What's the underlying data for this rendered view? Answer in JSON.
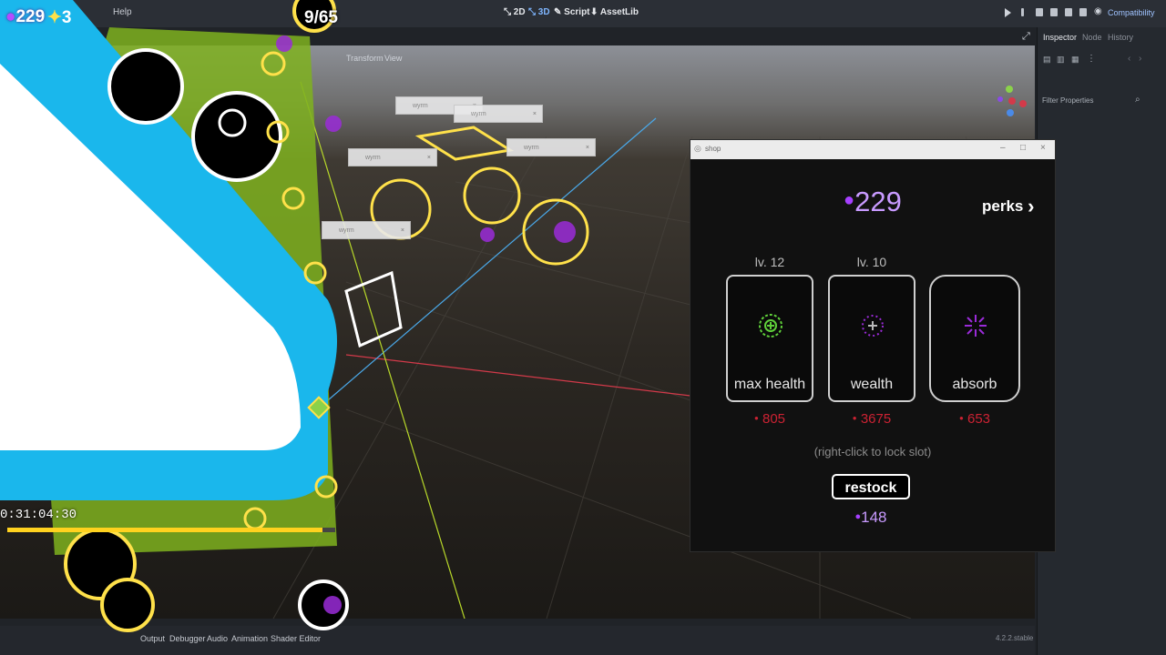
{
  "editor": {
    "menu": [
      "Help"
    ],
    "workspaces": [
      {
        "label": "2D",
        "icon": "2d-icon"
      },
      {
        "label": "3D",
        "icon": "3d-icon",
        "active": true
      },
      {
        "label": "Script",
        "icon": "script-icon"
      },
      {
        "label": "AssetLib",
        "icon": "assetlib-icon"
      }
    ],
    "renderer": "Compatibility",
    "viewport_menu": [
      "Transform",
      "View"
    ],
    "dock_tabs": [
      "Inspector",
      "Node",
      "History"
    ],
    "filter_placeholder": "Filter Properties",
    "bottom_tabs": [
      "Output",
      "Debugger",
      "Audio",
      "Animation",
      "Shader Editor"
    ],
    "version": "4.2.2.stable"
  },
  "hud": {
    "score": "229",
    "stars": "3",
    "enemy_count": "9/65",
    "timer": "0:31:04:30",
    "progress": 0.96
  },
  "mini_windows": [
    "wyrm",
    "wyrm",
    "wyrm",
    "wyrm",
    "wyrm"
  ],
  "shop": {
    "window_title": "shop",
    "coins": "229",
    "perks_label": "perks",
    "slots": [
      {
        "level": "lv. 12",
        "name": "max health",
        "price": "805",
        "icon": "max-health-icon"
      },
      {
        "level": "lv. 10",
        "name": "wealth",
        "price": "3675",
        "icon": "wealth-icon"
      },
      {
        "level": "",
        "name": "absorb",
        "price": "653",
        "icon": "absorb-icon"
      }
    ],
    "hint": "(right-click to lock slot)",
    "restock_label": "restock",
    "restock_price": "148"
  },
  "colors": {
    "accent_purple": "#a640ff",
    "price_red": "#cc2233",
    "hud_yellow": "#ffd21f",
    "cyan_shape": "#1ab7ec",
    "green_enemy": "#7fb21e"
  }
}
